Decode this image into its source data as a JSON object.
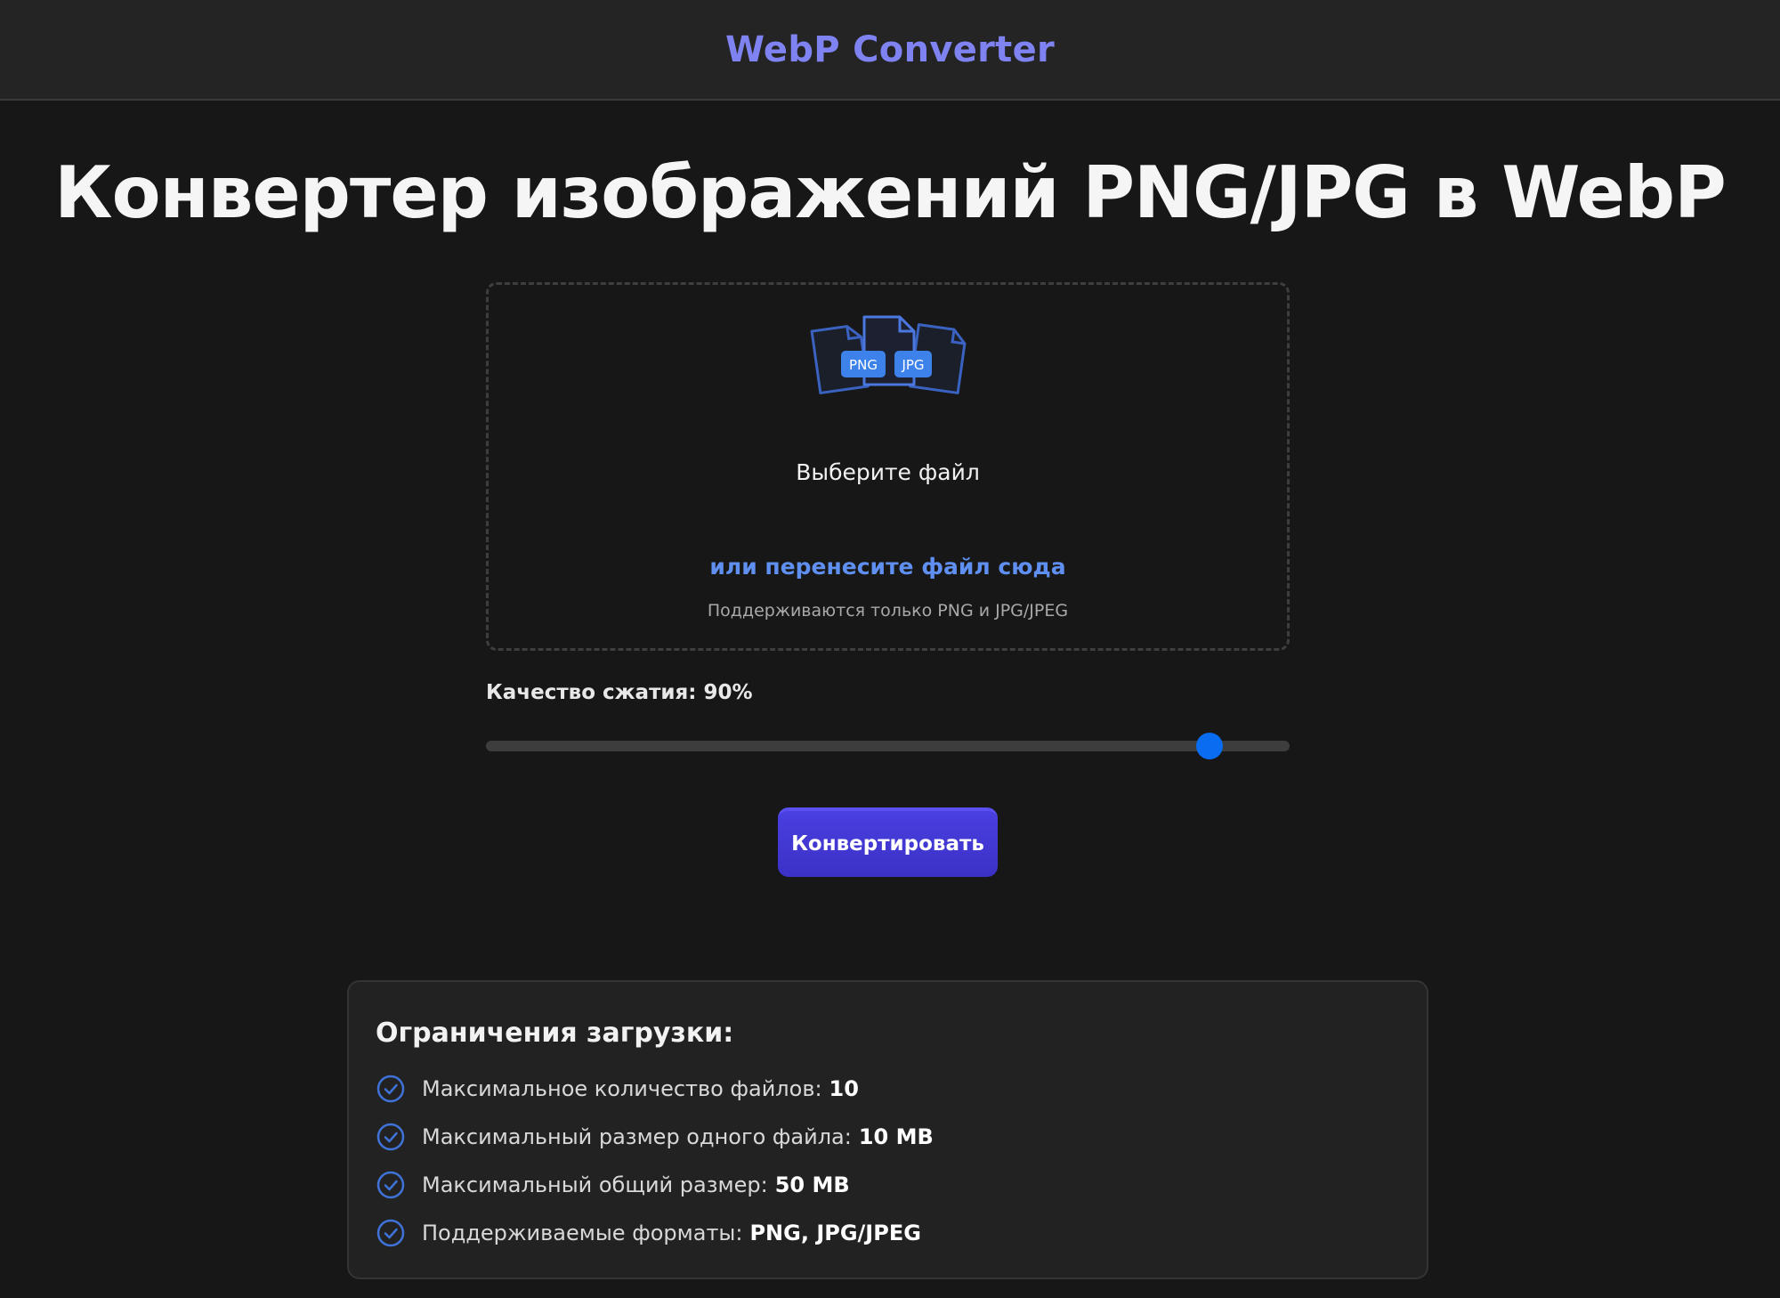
{
  "header": {
    "brand": "WebP Converter"
  },
  "page": {
    "title": "Конвертер изображений PNG/JPG в WebP"
  },
  "dropzone": {
    "badge_png": "PNG",
    "badge_jpg": "JPG",
    "choose_label": "Выберите файл",
    "drop_hint": "или перенесите файл сюда",
    "support_note": "Поддерживаются только PNG и JPG/JPEG"
  },
  "quality": {
    "label": "Качество сжатия:",
    "value_text": "90%",
    "value": 90
  },
  "convert_button": {
    "label": "Конвертировать"
  },
  "limits": {
    "title": "Ограничения загрузки:",
    "items": [
      {
        "label": "Максимальное количество файлов:",
        "value": "10"
      },
      {
        "label": "Максимальный размер одного файла:",
        "value": "10 MB"
      },
      {
        "label": "Максимальный общий размер:",
        "value": "50 MB"
      },
      {
        "label": "Поддерживаемые форматы:",
        "value": "PNG, JPG/JPEG"
      }
    ]
  },
  "colors": {
    "brand": "#7f83f2",
    "accent": "#0a6cf0",
    "button": "#3b31c6",
    "link": "#5f8ff0"
  },
  "icons": [
    "file-stack-icon",
    "check-circle-icon"
  ]
}
